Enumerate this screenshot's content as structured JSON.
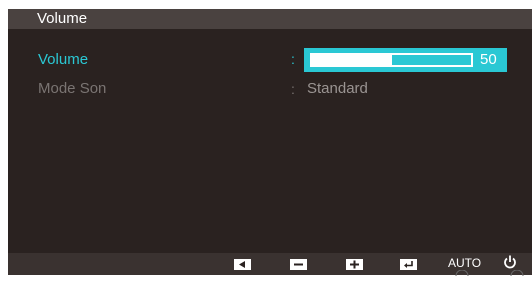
{
  "header": {
    "title": "Volume"
  },
  "menu": {
    "items": [
      {
        "label": "Volume",
        "separator": ":",
        "state": "selected"
      },
      {
        "label": "Mode Son",
        "separator": ":",
        "state": "inactive"
      }
    ]
  },
  "volume": {
    "value": "50",
    "level_fraction": 0.5
  },
  "mode_son": {
    "value": "Standard"
  },
  "bottom_bar": {
    "buttons": [
      {
        "name": "left-arrow-button",
        "icon": "left-triangle-icon"
      },
      {
        "name": "minus-button",
        "icon": "minus-icon"
      },
      {
        "name": "plus-button",
        "icon": "plus-icon"
      },
      {
        "name": "enter-button",
        "icon": "enter-icon"
      },
      {
        "name": "auto-button",
        "label": "AUTO"
      },
      {
        "name": "power-button",
        "icon": "power-icon"
      }
    ],
    "auto_label": "AUTO"
  },
  "colors": {
    "accent": "#2ac8d4",
    "panel_bg": "#2a2220",
    "header_bg": "#4a4240",
    "inactive_text": "#7a7472"
  }
}
